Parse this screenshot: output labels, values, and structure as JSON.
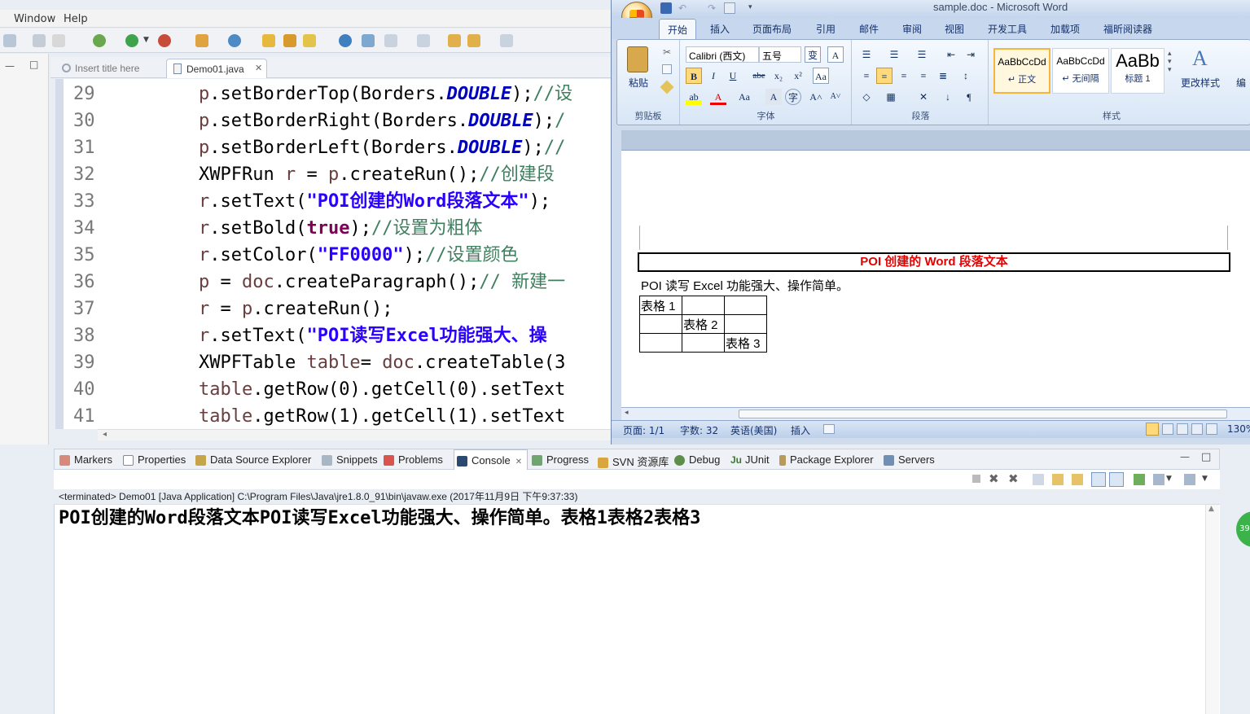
{
  "eclipse": {
    "menu": [
      "Window",
      "Help"
    ],
    "editor_tabs": [
      {
        "label": "Insert title here",
        "active": false
      },
      {
        "label": "Demo01.java",
        "active": true
      }
    ],
    "code_lines": [
      {
        "num": "29",
        "parts": [
          [
            "var",
            "p"
          ],
          [
            "",
            "."
          ],
          [
            "",
            "setBorderTop(Borders."
          ],
          [
            "fld",
            "DOUBLE"
          ],
          [
            "",
            ");"
          ],
          [
            "cmt",
            "//设"
          ]
        ]
      },
      {
        "num": "30",
        "parts": [
          [
            "var",
            "p"
          ],
          [
            "",
            "."
          ],
          [
            "",
            "setBorderRight(Borders."
          ],
          [
            "fld",
            "DOUBLE"
          ],
          [
            "",
            ");"
          ],
          [
            "cmt",
            "/"
          ]
        ]
      },
      {
        "num": "31",
        "parts": [
          [
            "var",
            "p"
          ],
          [
            "",
            "."
          ],
          [
            "",
            "setBorderLeft(Borders."
          ],
          [
            "fld",
            "DOUBLE"
          ],
          [
            "",
            ");"
          ],
          [
            "cmt",
            "//"
          ]
        ]
      },
      {
        "num": "32",
        "parts": [
          [
            "",
            "XWPFRun "
          ],
          [
            "var",
            "r"
          ],
          [
            "",
            " = "
          ],
          [
            "var",
            "p"
          ],
          [
            "",
            ".createRun();"
          ],
          [
            "cmt",
            "//创建段"
          ]
        ]
      },
      {
        "num": "33",
        "parts": [
          [
            "var",
            "r"
          ],
          [
            "",
            ".setText("
          ],
          [
            "str",
            "\"POI创建的Word段落文本\""
          ],
          [
            "",
            ");"
          ]
        ]
      },
      {
        "num": "34",
        "parts": [
          [
            "var",
            "r"
          ],
          [
            "",
            ".setBold("
          ],
          [
            "kw",
            "true"
          ],
          [
            "",
            ");"
          ],
          [
            "cmt",
            "//设置为粗体"
          ]
        ]
      },
      {
        "num": "35",
        "parts": [
          [
            "var",
            "r"
          ],
          [
            "",
            ".setColor("
          ],
          [
            "str",
            "\"FF0000\""
          ],
          [
            "",
            ");"
          ],
          [
            "cmt",
            "//设置颜色"
          ]
        ]
      },
      {
        "num": "36",
        "parts": [
          [
            "var",
            "p"
          ],
          [
            "",
            " = "
          ],
          [
            "var",
            "doc"
          ],
          [
            "",
            ".createParagraph();"
          ],
          [
            "cmt",
            "// 新建一"
          ]
        ]
      },
      {
        "num": "37",
        "parts": [
          [
            "var",
            "r"
          ],
          [
            "",
            " = "
          ],
          [
            "var",
            "p"
          ],
          [
            "",
            ".createRun();"
          ]
        ]
      },
      {
        "num": "38",
        "parts": [
          [
            "var",
            "r"
          ],
          [
            "",
            ".setText("
          ],
          [
            "str",
            "\"POI读写Excel功能强大、操"
          ]
        ]
      },
      {
        "num": "39",
        "parts": [
          [
            "",
            "XWPFTable "
          ],
          [
            "var",
            "table"
          ],
          [
            "",
            "= "
          ],
          [
            "var",
            "doc"
          ],
          [
            "",
            ".createTable(3"
          ]
        ]
      },
      {
        "num": "40",
        "parts": [
          [
            "var",
            "table"
          ],
          [
            "",
            ".getRow(0).getCell(0).setText"
          ]
        ]
      },
      {
        "num": "41",
        "parts": [
          [
            "var",
            "table"
          ],
          [
            "",
            ".getRow(1).getCell(1).setText"
          ]
        ]
      }
    ],
    "views": [
      "Markers",
      "Properties",
      "Data Source Explorer",
      "Snippets",
      "Problems",
      "Console",
      "Progress",
      "SVN 资源库",
      "Debug",
      "JUnit",
      "Package Explorer",
      "Servers"
    ],
    "terminated_line": "<terminated> Demo01 [Java Application] C:\\Program Files\\Java\\jre1.8.0_91\\bin\\javaw.exe (2017年11月9日 下午9:37:33)",
    "console_output": "POI创建的Word段落文本POI读写Excel功能强大、操作简单。表格1表格2表格3",
    "badge": "39"
  },
  "word": {
    "title": "sample.doc - Microsoft Word",
    "tabs": [
      "开始",
      "插入",
      "页面布局",
      "引用",
      "邮件",
      "审阅",
      "视图",
      "开发工具",
      "加载项",
      "福昕阅读器"
    ],
    "font_name": "Calibri (西文)",
    "font_size": "五号",
    "groups": [
      "剪贴板",
      "字体",
      "段落",
      "样式"
    ],
    "paste_label": "粘贴",
    "styles": [
      {
        "preview": "AaBbCcDd",
        "label": "↵ 正文"
      },
      {
        "preview": "AaBbCcDd",
        "label": "↵ 无间隔"
      },
      {
        "preview": "AaBb",
        "label": "标题 1"
      }
    ],
    "change_styles": "更改样式",
    "edit_label": "编",
    "doc": {
      "red_para": "POI 创建的 Word 段落文本",
      "para2": "POI 读写 Excel 功能强大、操作简单。",
      "table": [
        [
          "表格 1",
          "",
          ""
        ],
        [
          "",
          "表格 2",
          ""
        ],
        [
          "",
          "",
          "表格 3"
        ]
      ]
    },
    "status": {
      "page": "页面: 1/1",
      "words": "字数: 32",
      "lang": "英语(美国)",
      "mode": "插入",
      "zoom": "130%"
    }
  }
}
